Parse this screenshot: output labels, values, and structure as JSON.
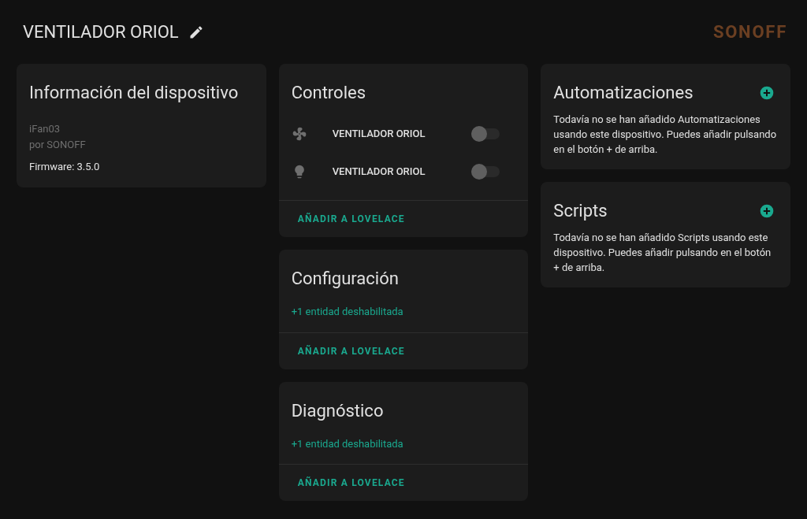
{
  "header": {
    "title": "VENTILADOR ORIOL",
    "logo": "SONOFF"
  },
  "device_info": {
    "title": "Información del dispositivo",
    "model": "iFan03",
    "manufacturer": "por SONOFF",
    "firmware": "Firmware: 3.5.0"
  },
  "entity_cards": [
    {
      "title": "Controles",
      "entities": [
        {
          "kind": "fan",
          "name": "VENTILADOR ORIOL",
          "on": false
        },
        {
          "kind": "light",
          "name": "VENTILADOR ORIOL",
          "on": false
        }
      ],
      "action": "AÑADIR A LOVELACE"
    },
    {
      "title": "Configuración",
      "disabled_note": "+1 entidad deshabilitada",
      "action": "AÑADIR A LOVELACE"
    },
    {
      "title": "Diagnóstico",
      "disabled_note": "+1 entidad deshabilitada",
      "action": "AÑADIR A LOVELACE"
    }
  ],
  "related_cards": [
    {
      "title": "Automatizaciones",
      "text": "Todavía no se han añadido Automatizaciones usando este dispositivo. Puedes añadir pulsando en el botón + de arriba."
    },
    {
      "title": "Scripts",
      "text": "Todavía no se han añadido Scripts usando este dispositivo. Puedes añadir pulsando en el botón + de arriba."
    }
  ]
}
